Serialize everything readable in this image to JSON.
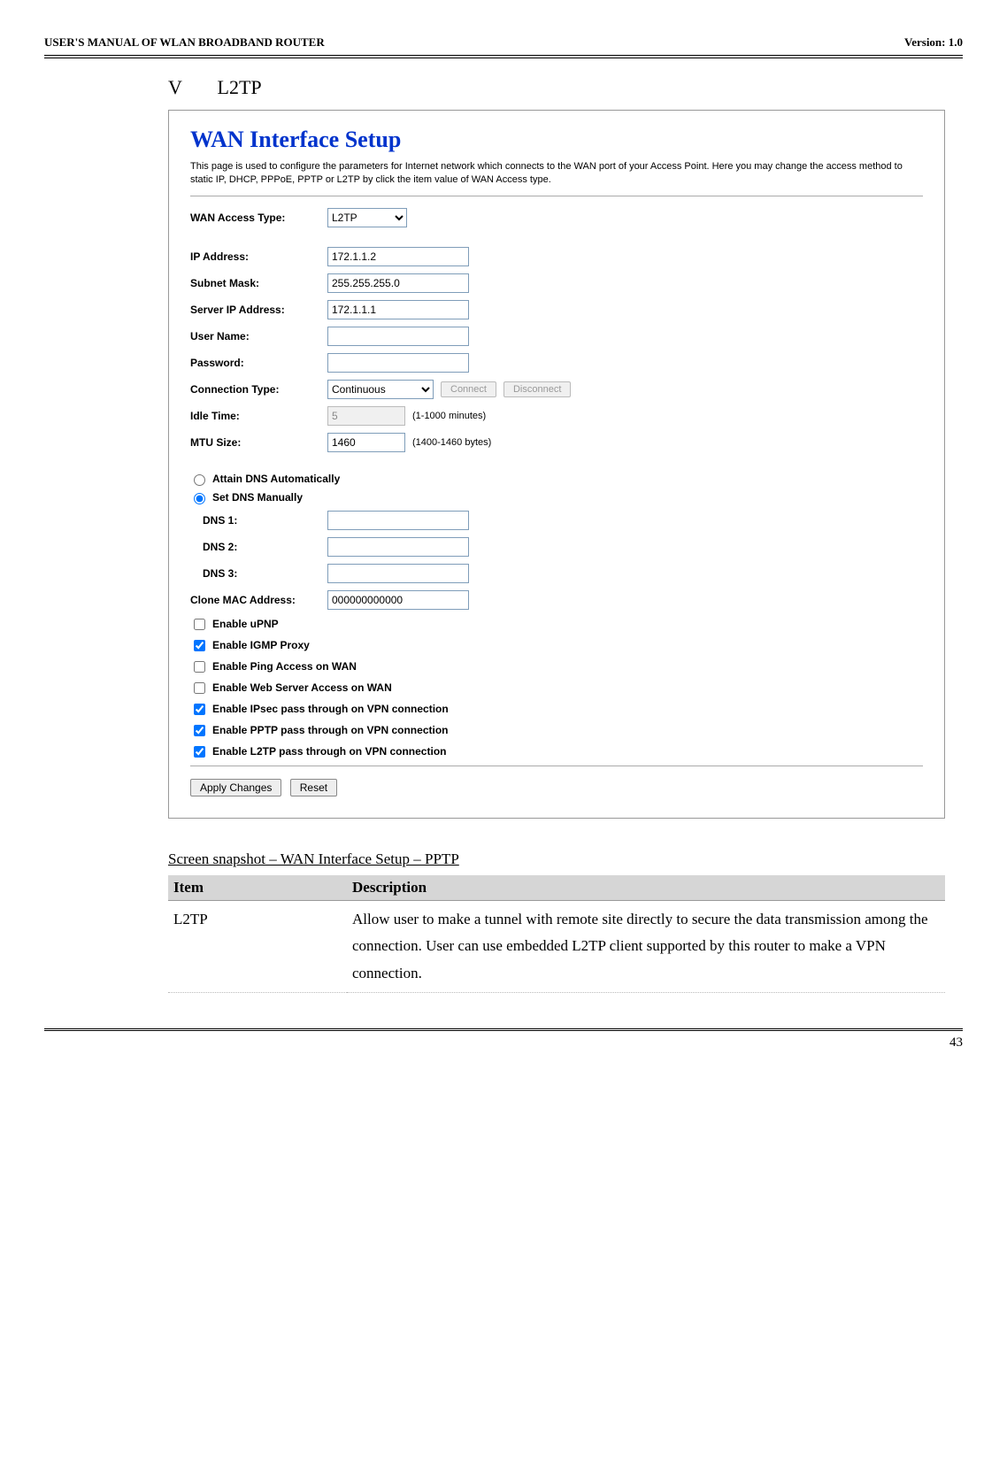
{
  "header": {
    "left": "USER'S MANUAL OF WLAN BROADBAND ROUTER",
    "right": "Version: 1.0"
  },
  "section": {
    "roman": "V",
    "title": "L2TP"
  },
  "setup": {
    "title": "WAN Interface Setup",
    "desc": "This page is used to configure the parameters for Internet network which connects to the WAN port of your Access Point. Here you may change the access method to static IP, DHCP, PPPoE, PPTP or L2TP by click the item value of WAN Access type."
  },
  "form": {
    "wan_access_type_label": "WAN Access Type:",
    "wan_access_type_value": "L2TP",
    "ip_address_label": "IP Address:",
    "ip_address_value": "172.1.1.2",
    "subnet_mask_label": "Subnet Mask:",
    "subnet_mask_value": "255.255.255.0",
    "server_ip_label": "Server IP Address:",
    "server_ip_value": "172.1.1.1",
    "user_name_label": "User Name:",
    "user_name_value": "",
    "password_label": "Password:",
    "password_value": "",
    "connection_type_label": "Connection Type:",
    "connection_type_value": "Continuous",
    "connect_btn": "Connect",
    "disconnect_btn": "Disconnect",
    "idle_time_label": "Idle Time:",
    "idle_time_value": "5",
    "idle_time_hint": "(1-1000 minutes)",
    "mtu_label": "MTU Size:",
    "mtu_value": "1460",
    "mtu_hint": "(1400-1460 bytes)",
    "dns_auto_label": "Attain DNS Automatically",
    "dns_manual_label": "Set DNS Manually",
    "dns1_label": "DNS 1:",
    "dns2_label": "DNS 2:",
    "dns3_label": "DNS 3:",
    "clone_mac_label": "Clone MAC Address:",
    "clone_mac_value": "000000000000",
    "chk_upnp": "Enable uPNP",
    "chk_igmp": "Enable IGMP Proxy",
    "chk_ping": "Enable Ping Access on WAN",
    "chk_web": "Enable Web Server Access on WAN",
    "chk_ipsec": "Enable IPsec pass through on VPN connection",
    "chk_pptp": "Enable PPTP pass through on VPN connection",
    "chk_l2tp": "Enable L2TP pass through on VPN connection",
    "apply_btn": "Apply Changes",
    "reset_btn": "Reset"
  },
  "caption": "Screen snapshot – WAN Interface Setup – PPTP",
  "table": {
    "h1": "Item",
    "h2": "Description",
    "r1c1": "L2TP",
    "r1c2": "Allow user to make a tunnel with remote site directly to secure the data transmission among the connection. User can use embedded L2TP client supported by this router to make a VPN connection."
  },
  "page_number": "43"
}
